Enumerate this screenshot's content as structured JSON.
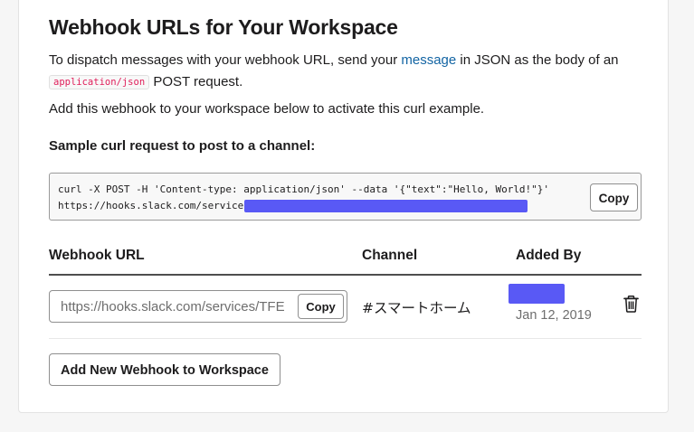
{
  "header": {
    "title": "Webhook URLs for Your Workspace"
  },
  "intro": {
    "text_before": "To dispatch messages with your webhook URL, send your ",
    "link": "message",
    "text_after": " in JSON as the body of an ",
    "code": "application/json",
    "text_end": " POST request."
  },
  "activate_text": "Add this webhook to your workspace below to activate this curl example.",
  "sample": {
    "label": "Sample curl request to post to a channel:",
    "code_line1": "curl -X POST -H 'Content-type: application/json' --data '{\"text\":\"Hello, World!\"}'",
    "code_line2": "https://hooks.slack.com/service",
    "copy_label": "Copy"
  },
  "table": {
    "headers": {
      "url": "Webhook URL",
      "channel": "Channel",
      "added_by": "Added By"
    },
    "rows": [
      {
        "url": "https://hooks.slack.com/services/TFE",
        "copy_label": "Copy",
        "channel": "#スマートホーム",
        "date": "Jan 12, 2019"
      }
    ]
  },
  "add_button": "Add New Webhook to Workspace",
  "colors": {
    "link": "#1264a3",
    "inline_code": "#e01e5a",
    "redaction": "#5959f5"
  },
  "icons": {
    "delete": "trash-icon"
  }
}
